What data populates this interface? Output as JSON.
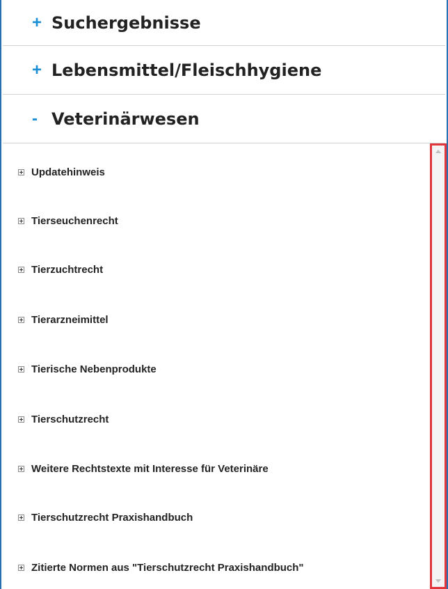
{
  "sections": [
    {
      "toggle": "+",
      "title": "Suchergebnisse"
    },
    {
      "toggle": "+",
      "title": "Lebensmittel/Fleischhygiene"
    },
    {
      "toggle": "-",
      "title": "Veterinärwesen"
    }
  ],
  "tree": {
    "items": [
      {
        "label": "Updatehinweis"
      },
      {
        "label": "Tierseuchenrecht"
      },
      {
        "label": "Tierzuchtrecht"
      },
      {
        "label": "Tierarzneimittel"
      },
      {
        "label": "Tierische Nebenprodukte"
      },
      {
        "label": "Tierschutzrecht"
      },
      {
        "label": "Weitere Rechtstexte mit Interesse für Veterinäre"
      },
      {
        "label": "Tierschutzrecht Praxishandbuch"
      },
      {
        "label": "Zitierte Normen aus \"Tierschutzrecht Praxishandbuch\""
      }
    ]
  },
  "colors": {
    "accent": "#1a8fd6",
    "frame_border": "#2a6fb0",
    "scrollbar_highlight": "#e0363b"
  }
}
